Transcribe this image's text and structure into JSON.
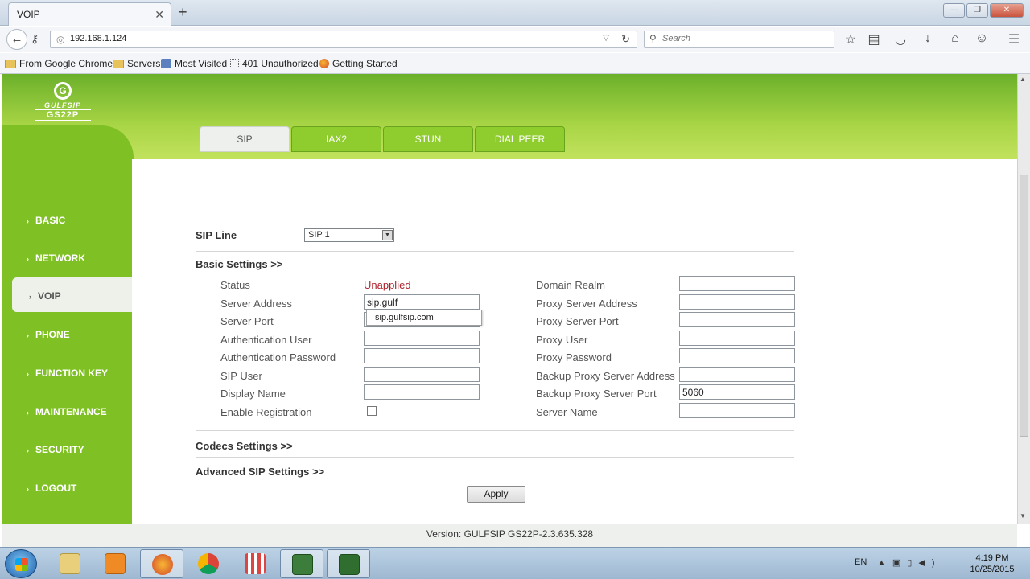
{
  "browser": {
    "tab_title": "VOIP",
    "url": "192.168.1.124",
    "search_placeholder": "Search",
    "bookmarks": [
      "From Google Chrome",
      "Servers",
      "Most Visited",
      "401 Unauthorized",
      "Getting Started"
    ]
  },
  "header": {
    "logo_brand": "GULFSIP",
    "logo_model": "GS22P"
  },
  "tabs": [
    "SIP",
    "IAX2",
    "STUN",
    "DIAL PEER"
  ],
  "sidebar": {
    "items": [
      "BASIC",
      "NETWORK",
      "VOIP",
      "PHONE",
      "FUNCTION KEY",
      "MAINTENANCE",
      "SECURITY",
      "LOGOUT"
    ]
  },
  "form": {
    "sip_line_label": "SIP Line",
    "sip_line_value": "SIP 1",
    "basic_settings": "Basic Settings >>",
    "left_fields": [
      {
        "label": "Status",
        "value": "Unapplied"
      },
      {
        "label": "Server Address",
        "value": "sip.gulf"
      },
      {
        "label": "Server Port",
        "value": ""
      },
      {
        "label": "Authentication User",
        "value": ""
      },
      {
        "label": "Authentication Password",
        "value": ""
      },
      {
        "label": "SIP User",
        "value": ""
      },
      {
        "label": "Display Name",
        "value": ""
      },
      {
        "label": "Enable Registration",
        "value": ""
      }
    ],
    "right_fields": [
      {
        "label": "Domain Realm",
        "value": ""
      },
      {
        "label": "Proxy Server Address",
        "value": ""
      },
      {
        "label": "Proxy Server Port",
        "value": ""
      },
      {
        "label": "Proxy User",
        "value": ""
      },
      {
        "label": "Proxy Password",
        "value": ""
      },
      {
        "label": "Backup Proxy Server Address",
        "value": ""
      },
      {
        "label": "Backup Proxy Server Port",
        "value": "5060"
      },
      {
        "label": "Server Name",
        "value": ""
      }
    ],
    "autocomplete_suggestion": "sip.gulfsip.com",
    "codecs_settings": "Codecs Settings >>",
    "advanced_settings": "Advanced SIP Settings >>",
    "apply_label": "Apply"
  },
  "footer": {
    "version": "Version: GULFSIP GS22P-2.3.635.328"
  },
  "taskbar": {
    "lang": "EN",
    "time": "4:19 PM",
    "date": "10/25/2015"
  },
  "colors": {
    "sidebar_green": "#7fc024",
    "status_red": "#b0232d"
  }
}
